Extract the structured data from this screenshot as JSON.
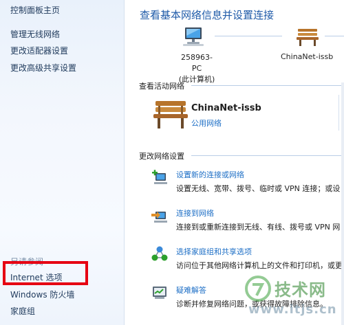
{
  "sidebar": {
    "home_link": "控制面板主页",
    "links": [
      "管理无线网络",
      "更改适配器设置",
      "更改高级共享设置"
    ],
    "see_also_label": "另请参阅",
    "see_also": [
      "Internet 选项",
      "Windows 防火墙",
      "家庭组"
    ],
    "highlight_color": "#e60012"
  },
  "main": {
    "title": "查看基本网络信息并设置连接",
    "computer": {
      "name": "258963-PC",
      "subtitle": "(此计算机)"
    },
    "network_top": {
      "name": "ChinaNet-issb"
    },
    "active_header": "查看活动网络",
    "active": {
      "name": "ChinaNet-issb",
      "type": "公用网络"
    },
    "settings_header": "更改网络设置",
    "tasks": [
      {
        "icon": "new-connection-icon",
        "link": "设置新的连接或网络",
        "desc": "设置无线、宽带、拨号、临时或 VPN 连接；或设"
      },
      {
        "icon": "connect-network-icon",
        "link": "连接到网络",
        "desc": "连接到或重新连接到无线、有线、拨号或 VPN 网"
      },
      {
        "icon": "homegroup-icon",
        "link": "选择家庭组和共享选项",
        "desc": "访问位于其他网络计算机上的文件和打印机，或更"
      },
      {
        "icon": "troubleshoot-icon",
        "link": "疑难解答",
        "desc": "诊断并修复网络问题，或获得故障排除信息。"
      }
    ]
  },
  "watermark": {
    "text": "技术网",
    "url": "www.itjs.cn"
  },
  "colors": {
    "link": "#1e6fc6",
    "title": "#1e5aa8",
    "sidebar_text": "#1e395b"
  }
}
